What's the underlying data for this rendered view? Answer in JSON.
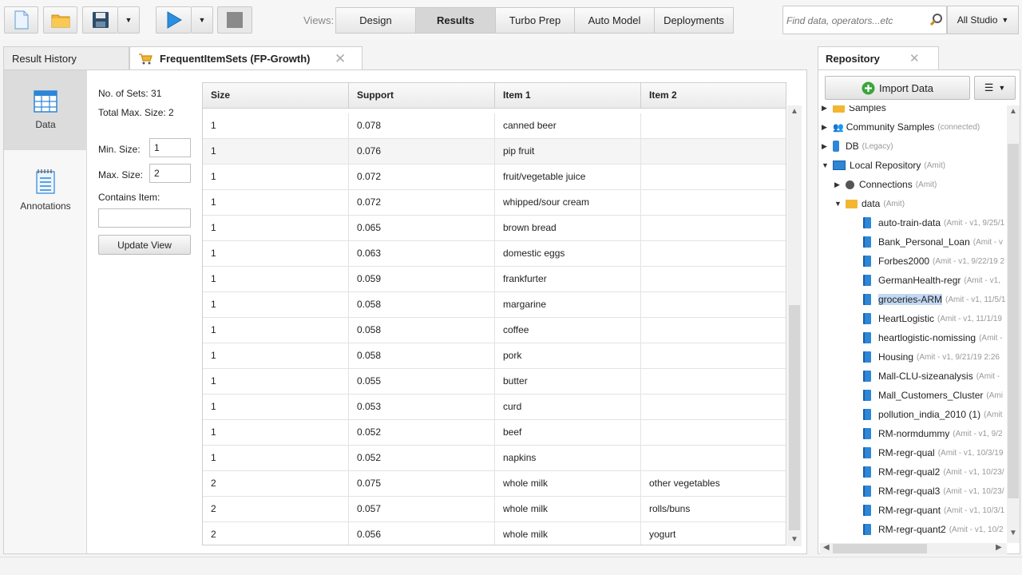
{
  "toolbar": {
    "views_label": "Views:",
    "views": [
      {
        "label": "Design",
        "active": false
      },
      {
        "label": "Results",
        "active": true
      },
      {
        "label": "Turbo Prep",
        "active": false
      },
      {
        "label": "Auto Model",
        "active": false
      },
      {
        "label": "Deployments",
        "active": false
      }
    ],
    "search_placeholder": "Find data, operators...etc",
    "studio_label": "All Studio",
    "icons": [
      "new-file-icon",
      "open-folder-icon",
      "save-icon",
      "dropdown-arrow-icon",
      "run-play-icon",
      "stop-icon"
    ]
  },
  "tabs": {
    "result_history": "Result History",
    "active_tab": "FrequentItemSets (FP-Growth)"
  },
  "sidebar": {
    "items": [
      {
        "label": "Data",
        "icon": "table-icon",
        "active": true
      },
      {
        "label": "Annotations",
        "icon": "notepad-icon",
        "active": false
      }
    ]
  },
  "controls": {
    "no_of_sets": "No. of Sets: 31",
    "total_max_size": "Total Max. Size: 2",
    "min_size_label": "Min. Size:",
    "min_size_value": "1",
    "max_size_label": "Max. Size:",
    "max_size_value": "2",
    "contains_item_label": "Contains Item:",
    "contains_item_value": "",
    "update_button": "Update View"
  },
  "table": {
    "columns": [
      "Size",
      "Support",
      "Item 1",
      "Item 2"
    ],
    "rows": [
      [
        "1",
        "0.078",
        "canned beer",
        ""
      ],
      [
        "1",
        "0.076",
        "pip fruit",
        ""
      ],
      [
        "1",
        "0.072",
        "fruit/vegetable juice",
        ""
      ],
      [
        "1",
        "0.072",
        "whipped/sour cream",
        ""
      ],
      [
        "1",
        "0.065",
        "brown bread",
        ""
      ],
      [
        "1",
        "0.063",
        "domestic eggs",
        ""
      ],
      [
        "1",
        "0.059",
        "frankfurter",
        ""
      ],
      [
        "1",
        "0.058",
        "margarine",
        ""
      ],
      [
        "1",
        "0.058",
        "coffee",
        ""
      ],
      [
        "1",
        "0.058",
        "pork",
        ""
      ],
      [
        "1",
        "0.055",
        "butter",
        ""
      ],
      [
        "1",
        "0.053",
        "curd",
        ""
      ],
      [
        "1",
        "0.052",
        "beef",
        ""
      ],
      [
        "1",
        "0.052",
        "napkins",
        ""
      ],
      [
        "2",
        "0.075",
        "whole milk",
        "other vegetables"
      ],
      [
        "2",
        "0.057",
        "whole milk",
        "rolls/buns"
      ],
      [
        "2",
        "0.056",
        "whole milk",
        "yogurt"
      ]
    ]
  },
  "repository": {
    "title": "Repository",
    "import_label": "Import Data",
    "items": [
      {
        "name": "Samples",
        "meta": "",
        "kind": "folder",
        "arrow": "▶",
        "level": 0
      },
      {
        "name": "Community Samples",
        "meta": "(connected)",
        "kind": "people",
        "arrow": "▶",
        "level": 0
      },
      {
        "name": "DB",
        "meta": "(Legacy)",
        "kind": "db",
        "arrow": "▶",
        "level": 0
      },
      {
        "name": "Local Repository",
        "meta": "(Amit)",
        "kind": "monitor",
        "arrow": "▼",
        "level": 0
      },
      {
        "name": "Connections",
        "meta": "(Amit)",
        "kind": "plug",
        "arrow": "▶",
        "level": 1
      },
      {
        "name": "data",
        "meta": "(Amit)",
        "kind": "folder",
        "arrow": "▼",
        "level": 1
      },
      {
        "name": "auto-train-data",
        "meta": "(Amit - v1, 9/25/1",
        "kind": "data",
        "arrow": "",
        "level": 2
      },
      {
        "name": "Bank_Personal_Loan",
        "meta": "(Amit - v",
        "kind": "data",
        "arrow": "",
        "level": 2
      },
      {
        "name": "Forbes2000",
        "meta": "(Amit - v1, 9/22/19 2",
        "kind": "data",
        "arrow": "",
        "level": 2
      },
      {
        "name": "GermanHealth-regr",
        "meta": "(Amit - v1,",
        "kind": "data",
        "arrow": "",
        "level": 2
      },
      {
        "name": "groceries-ARM",
        "meta": "(Amit - v1, 11/5/1",
        "kind": "data",
        "arrow": "",
        "level": 2,
        "selected": true
      },
      {
        "name": "HeartLogistic",
        "meta": "(Amit - v1, 11/1/19",
        "kind": "data",
        "arrow": "",
        "level": 2
      },
      {
        "name": "heartlogistic-nomissing",
        "meta": "(Amit -",
        "kind": "data",
        "arrow": "",
        "level": 2
      },
      {
        "name": "Housing",
        "meta": "(Amit - v1, 9/21/19 2:26",
        "kind": "data",
        "arrow": "",
        "level": 2
      },
      {
        "name": "Mall-CLU-sizeanalysis",
        "meta": "(Amit -",
        "kind": "data",
        "arrow": "",
        "level": 2
      },
      {
        "name": "Mall_Customers_Cluster",
        "meta": "(Ami",
        "kind": "data",
        "arrow": "",
        "level": 2
      },
      {
        "name": "pollution_india_2010 (1)",
        "meta": "(Amit",
        "kind": "data",
        "arrow": "",
        "level": 2
      },
      {
        "name": "RM-normdummy",
        "meta": "(Amit - v1, 9/2",
        "kind": "data",
        "arrow": "",
        "level": 2
      },
      {
        "name": "RM-regr-qual",
        "meta": "(Amit - v1, 10/3/19",
        "kind": "data",
        "arrow": "",
        "level": 2
      },
      {
        "name": "RM-regr-qual2",
        "meta": "(Amit - v1, 10/23/",
        "kind": "data",
        "arrow": "",
        "level": 2
      },
      {
        "name": "RM-regr-qual3",
        "meta": "(Amit - v1, 10/23/",
        "kind": "data",
        "arrow": "",
        "level": 2
      },
      {
        "name": "RM-regr-quant",
        "meta": "(Amit - v1, 10/3/1",
        "kind": "data",
        "arrow": "",
        "level": 2
      },
      {
        "name": "RM-regr-quant2",
        "meta": "(Amit - v1, 10/2",
        "kind": "data",
        "arrow": "",
        "level": 2
      }
    ]
  }
}
